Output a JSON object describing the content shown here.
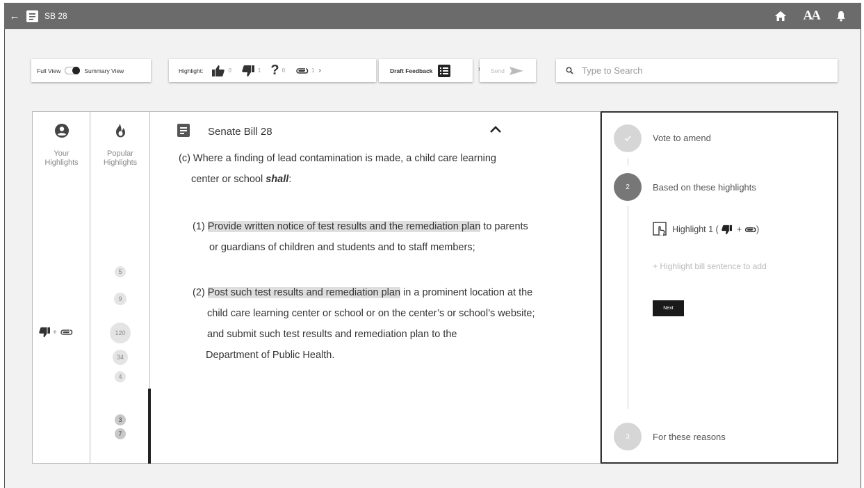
{
  "app": {
    "title": "SB 28"
  },
  "toolbar": {
    "full_view": "Full View",
    "summary_view": "Summary View",
    "highlight_label": "Highlight:",
    "thumbs_up_count": "0",
    "thumbs_down_count": "1",
    "question_count": "0",
    "clip_count": "1",
    "draft_feedback": "Draft Feedback",
    "send": "Send"
  },
  "search": {
    "placeholder": "Type to Search"
  },
  "sidebar": {
    "your_highlights": [
      "Your",
      "Highlights"
    ],
    "popular_highlights": [
      "Popular",
      "Highlights"
    ],
    "popular_counts": [
      "5",
      "9",
      "120",
      "34",
      "4",
      "3",
      "7"
    ]
  },
  "bill": {
    "title": "Senate Bill 28",
    "intro_line1": "(c) Where a finding of lead contamination is made, a child care learning",
    "intro_line2_pre": "center or school ",
    "intro_shall": "shall",
    "intro_line2_post": ":",
    "item1_prefix": "(1) ",
    "item1_highlight": "Provide written notice of test results and the remediation plan",
    "item1_rest": " to parents",
    "item1_line2": "or guardians of children and students and to staff members;",
    "item2_prefix": "(2) ",
    "item2_highlight": "Post such test results and remediation plan",
    "item2_rest": " in a prominent location at the",
    "item2_line2": "child care learning center or school or on the center’s or school’s website;",
    "item2_line3": "and submit such test results and remediation plan to the",
    "item2_line4": "Department of Public Health."
  },
  "steps": {
    "step1_label": "Vote to amend",
    "step2_number": "2",
    "step2_label": "Based on these highlights",
    "highlight1_pre": "Highlight 1 (",
    "highlight1_plus": "+",
    "highlight1_post": ")",
    "add_hint": "+ Highlight bill sentence to add",
    "next": "Next",
    "step3_number": "3",
    "step3_label": "For these reasons"
  },
  "colors": {
    "appbar": "#6b6b6b",
    "highlight": "#dedede",
    "dark": "#1a1a1a"
  }
}
